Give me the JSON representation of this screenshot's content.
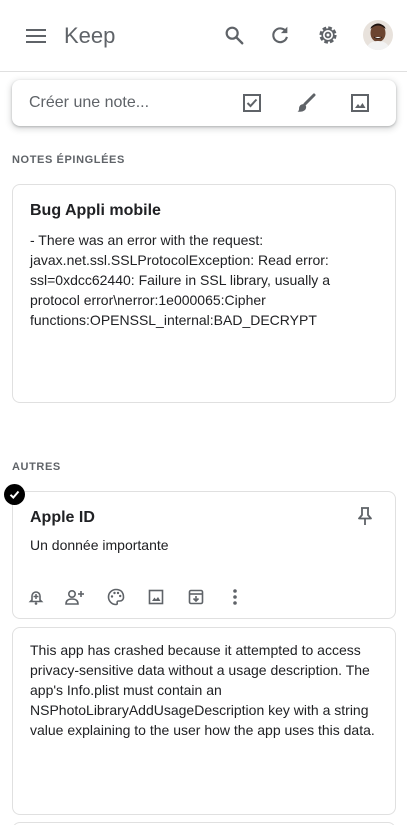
{
  "header": {
    "title": "Keep",
    "icons": [
      "menu-icon",
      "search-icon",
      "refresh-icon",
      "settings-icon",
      "avatar"
    ]
  },
  "composer": {
    "placeholder": "Créer une note...",
    "icons": [
      "checkbox-icon",
      "brush-icon",
      "image-icon"
    ]
  },
  "sections": {
    "pinned_label": "NOTES ÉPINGLÉES",
    "others_label": "AUTRES"
  },
  "notes": {
    "pinned": [
      {
        "title": "Bug Appli mobile",
        "body": "- There was an error with the request: javax.net.ssl.SSLProtocolException: Read error: ssl=0xdcc62440: Failure in SSL library, usually a protocol error\\nerror:1e000065:Cipher functions:OPENSSL_internal:BAD_DECRYPT"
      }
    ],
    "others": [
      {
        "title": "Apple ID",
        "body": "Un donnée importante",
        "selected": true,
        "toolbar": [
          "remind-icon",
          "collaborator-icon",
          "palette-icon",
          "image-icon",
          "archive-icon",
          "more-icon"
        ]
      },
      {
        "title": "",
        "body": "This app has crashed because it attempted to access privacy-sensitive data without a usage description.  The app's Info.plist must contain an NSPhotoLibraryAddUsageDescription key with a string value explaining to the user how the app uses this data."
      }
    ]
  },
  "colors": {
    "icon": "#5f6368",
    "text": "#202124",
    "border": "#e0e0e0"
  }
}
